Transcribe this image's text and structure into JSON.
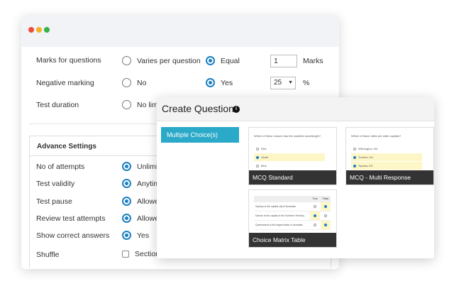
{
  "settings": {
    "marks": {
      "label": "Marks for questions",
      "opt1": "Varies per question",
      "opt2": "Equal",
      "value": "1",
      "unit": "Marks"
    },
    "negative": {
      "label": "Negative marking",
      "opt1": "No",
      "opt2": "Yes",
      "value": "25",
      "unit": "%"
    },
    "duration": {
      "label": "Test duration",
      "opt1": "No limi"
    }
  },
  "advance": {
    "title": "Advance Settings",
    "rows": [
      {
        "label": "No of attempts",
        "value": "Unlimi"
      },
      {
        "label": "Test validity",
        "value": "Anytim"
      },
      {
        "label": "Test pause",
        "value": "Allowe"
      },
      {
        "label": "Review test attempts",
        "value": "Allowe"
      },
      {
        "label": "Show correct answers",
        "value": "Yes"
      },
      {
        "label": "Shuffle",
        "value": "Sections"
      }
    ]
  },
  "dialog": {
    "title": "Create Question",
    "info_icon": "info-icon",
    "category": "Multiple Choice(s)",
    "cards": {
      "mcq": {
        "label": "MCQ Standard",
        "question": "Which of these colours has the smallest wavelength?",
        "options": [
          "Red",
          "Violet",
          "Blue"
        ]
      },
      "multi": {
        "label": "MCQ - Multi Response",
        "question": "Which of these cities are state capitals?",
        "options": [
          "Wilmington, NC",
          "Trenton, NJ",
          "Topeka, KS"
        ]
      },
      "matrix": {
        "label": "Choice Matrix Table",
        "col_true": "True",
        "col_false": "False",
        "rows": [
          "Sydney is the capital city of Australia",
          "Darwin is the capital of the Northern Territory",
          "Queensland is the largest state in Australia"
        ]
      }
    }
  },
  "colors": {
    "accent": "#1d7fc1",
    "category_button": "#2aa9c8",
    "card_bar": "#333333"
  }
}
